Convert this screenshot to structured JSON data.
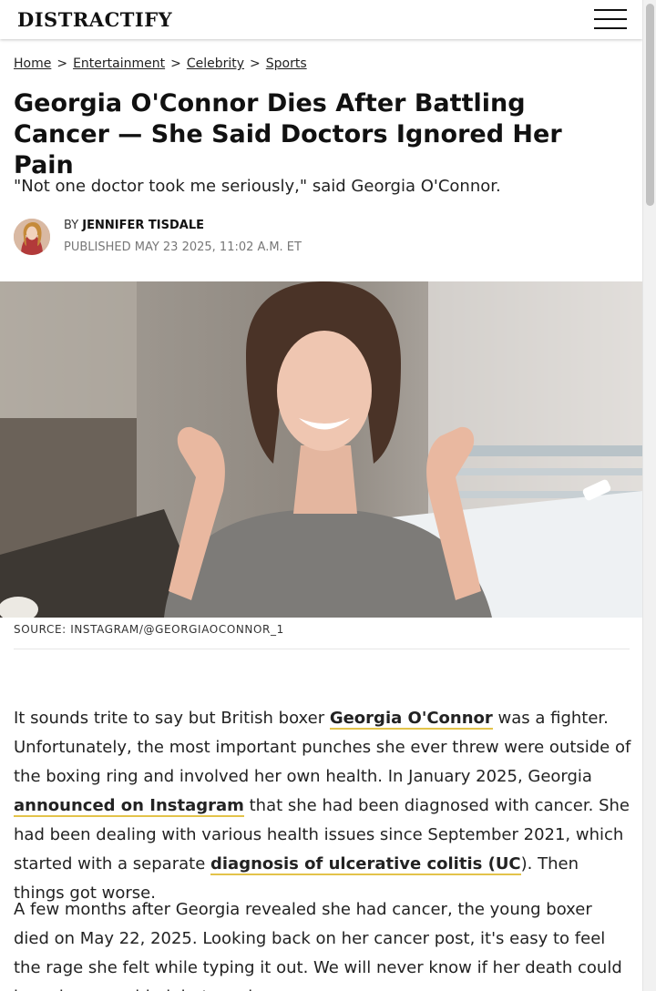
{
  "header": {
    "logo_text": "DISTRACTIFY",
    "menu_icon": "hamburger-menu-icon"
  },
  "breadcrumb": {
    "items": [
      "Home",
      "Entertainment",
      "Celebrity",
      "Sports"
    ],
    "separator": ">"
  },
  "article": {
    "headline": "Georgia O'Connor Dies After Battling Cancer — She Said Doctors Ignored Her Pain",
    "dek": "\"Not one doctor took me seriously,\" said Georgia O'Connor.",
    "byline_prefix": "BY",
    "author": "Jennifer Tisdale",
    "published": "PUBLISHED MAY 23 2025, 11:02 A.M. ET",
    "image_caption": "Source: Instagram/@georgiaoconnor_1",
    "paragraphs": [
      {
        "t1": "It sounds trite to say but British boxer ",
        "l1": "Georgia O'Connor",
        "t2": " was a fighter. Unfortunately, the most important punches she ever threw were outside of the boxing ring and involved her own health. In January 2025, Georgia ",
        "l2": "announced on Instagram",
        "t3": " that she had been diagnosed with cancer. She had been dealing with various health issues since September 2021, which started with a separate ",
        "l3": "diagnosis of ulcerative colitis (UC",
        "t4": "). Then things got worse."
      },
      {
        "t1": "A few months after Georgia revealed she had cancer, the young boxer died on May 22, 2025. Looking back on her cancer post, it's easy to feel the rage she felt while typing it out. We will never know if her death could have been avoided, but we do"
      }
    ]
  },
  "colors": {
    "link_underline": "#e3c34a",
    "text": "#222222",
    "meta": "#777777"
  }
}
